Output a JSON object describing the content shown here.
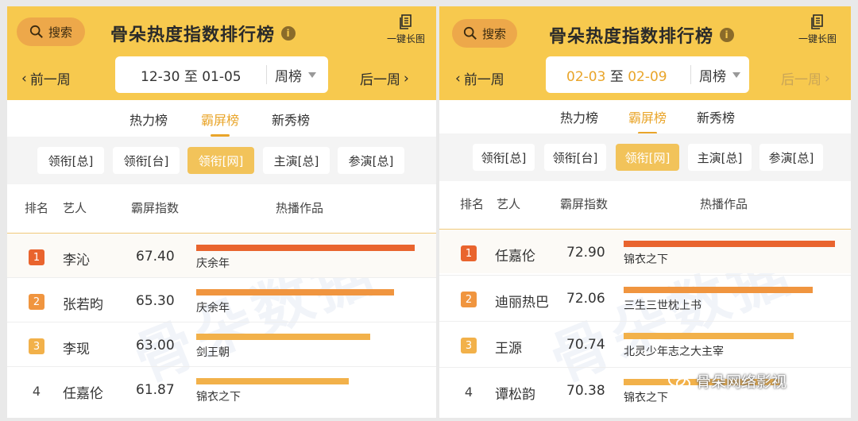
{
  "common": {
    "search_label": "搜索",
    "title": "骨朵热度指数排行榜",
    "info_glyph": "i",
    "long_image_label": "一键长图",
    "prev_week": "前一周",
    "next_week": "后一周",
    "period": "周榜",
    "date_separator": "至",
    "tabs": [
      "热力榜",
      "霸屏榜",
      "新秀榜"
    ],
    "filters": [
      "领衔[总]",
      "领衔[台]",
      "领衔[网]",
      "主演[总]",
      "参演[总]"
    ],
    "headers": {
      "rank": "排名",
      "artist": "艺人",
      "score": "霸屏指数",
      "works": "热播作品"
    },
    "watermark": "骨朵数据",
    "colors": {
      "header_bg": "#f7c94e",
      "accent": "#e9a52a",
      "rank1": "#e9642e",
      "rank2": "#f0953f",
      "rank3": "#f2b14a"
    }
  },
  "left": {
    "date_from": "12-30",
    "date_to": "01-05",
    "active_tab": "霸屏榜",
    "active_filter": "领衔[网]",
    "rows": [
      {
        "rank": "1",
        "artist": "李沁",
        "score": "67.40",
        "work": "庆余年",
        "level": 0.93
      },
      {
        "rank": "2",
        "artist": "张若昀",
        "score": "65.30",
        "work": "庆余年",
        "level": 0.84
      },
      {
        "rank": "3",
        "artist": "李现",
        "score": "63.00",
        "work": "剑王朝",
        "level": 0.74
      },
      {
        "rank": "4",
        "artist": "任嘉伦",
        "score": "61.87",
        "work": "锦衣之下",
        "level": 0.65
      }
    ]
  },
  "right": {
    "date_from": "02-03",
    "date_to": "02-09",
    "active_tab": "霸屏榜",
    "active_filter": "领衔[网]",
    "rows": [
      {
        "rank": "1",
        "artist": "任嘉伦",
        "score": "72.90",
        "work": "锦衣之下",
        "level": 0.97
      },
      {
        "rank": "2",
        "artist": "迪丽热巴",
        "score": "72.06",
        "work": "三生三世枕上书",
        "level": 0.87
      },
      {
        "rank": "3",
        "artist": "王源",
        "score": "70.74",
        "work": "北灵少年志之大主宰",
        "level": 0.78
      },
      {
        "rank": "4",
        "artist": "谭松韵",
        "score": "70.38",
        "work": "锦衣之下",
        "level": 0.72
      }
    ]
  },
  "source_mark": "骨朵网络影视"
}
